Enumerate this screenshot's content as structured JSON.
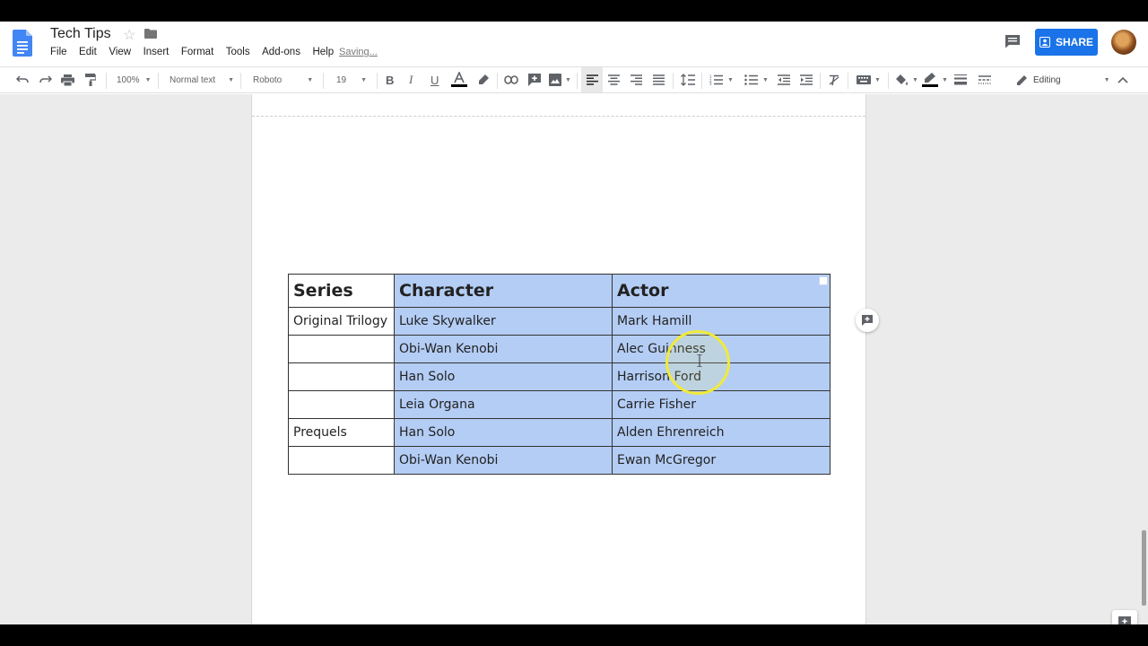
{
  "document": {
    "title": "Tech Tips",
    "saving_status": "Saving..."
  },
  "menu": [
    "File",
    "Edit",
    "View",
    "Insert",
    "Format",
    "Tools",
    "Add-ons",
    "Help"
  ],
  "share": {
    "label": "SHARE"
  },
  "toolbar": {
    "zoom": "100%",
    "style": "Normal text",
    "font": "Roboto",
    "font_size": "19",
    "mode": "Editing"
  },
  "table": {
    "headers": [
      "Series",
      "Character",
      "Actor"
    ],
    "rows": [
      [
        "Original Trilogy",
        "Luke Skywalker",
        "Mark Hamill"
      ],
      [
        "",
        "Obi-Wan Kenobi",
        "Alec Guinness"
      ],
      [
        "",
        "Han Solo",
        "Harrison Ford"
      ],
      [
        "",
        "Leia Organa",
        "Carrie Fisher"
      ],
      [
        "Prequels",
        "Han Solo",
        "Alden Ehrenreich"
      ],
      [
        "",
        "Obi-Wan Kenobi",
        "Ewan McGregor"
      ]
    ]
  },
  "colors": {
    "brand": "#4285f4",
    "share_button": "#1a73e8",
    "selection": "#b4cdf5",
    "canvas": "#ebebeb",
    "cursor_highlight": "#f0ea3a"
  },
  "icons": [
    "docs-logo-icon",
    "star-icon",
    "folder-icon",
    "comment-icon",
    "share-person-icon",
    "undo-icon",
    "redo-icon",
    "print-icon",
    "paint-format-icon",
    "bold-icon",
    "italic-icon",
    "underline-icon",
    "text-color-icon",
    "highlight-icon",
    "link-icon",
    "add-comment-icon",
    "image-icon",
    "align-left-icon",
    "align-center-icon",
    "align-right-icon",
    "justify-icon",
    "line-spacing-icon",
    "numbered-list-icon",
    "bulleted-list-icon",
    "decrease-indent-icon",
    "increase-indent-icon",
    "clear-formatting-icon",
    "input-tools-icon",
    "fill-color-icon",
    "border-color-icon",
    "border-width-icon",
    "border-dash-icon",
    "pencil-icon",
    "collapse-icon",
    "explore-icon"
  ]
}
